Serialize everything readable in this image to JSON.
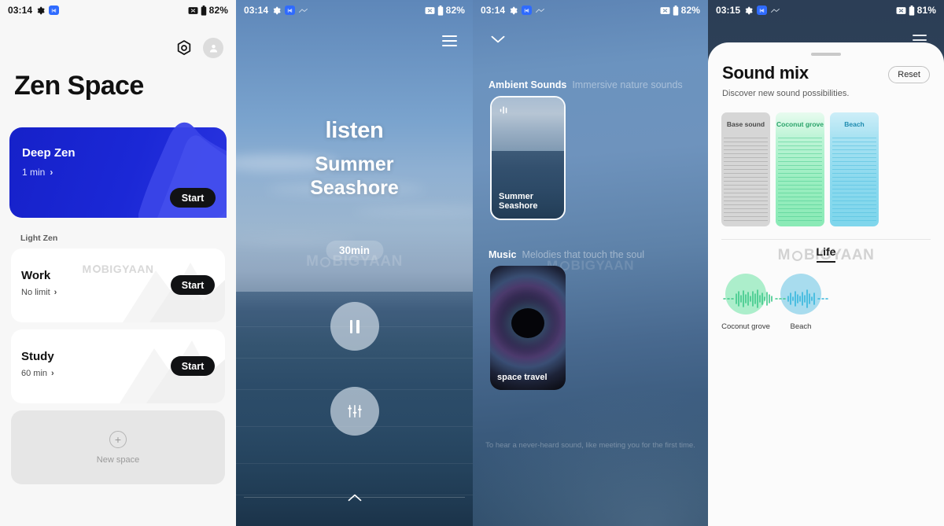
{
  "app": {
    "name": "Zen Space"
  },
  "panels": [
    {
      "id": "home",
      "statusbar": {
        "time": "03:14",
        "battery_pct": "82%",
        "icons": [
          "gear-icon",
          "dnd-badge-icon",
          "mute-icon",
          "battery-icon"
        ]
      },
      "header": {
        "title": "Zen Space",
        "settings_icon": "hex-gear-icon",
        "profile_icon": "avatar-icon"
      },
      "featured": {
        "name": "Deep Zen",
        "duration": "1 min",
        "chevron": "›",
        "start_label": "Start",
        "color": "#1b28d6"
      },
      "section_label": "Light Zen",
      "spaces": [
        {
          "name": "Work",
          "duration": "No limit",
          "chevron": "›",
          "start_label": "Start"
        },
        {
          "name": "Study",
          "duration": "60 min",
          "chevron": "›",
          "start_label": "Start"
        }
      ],
      "new_space": {
        "label": "New space",
        "icon": "plus-icon"
      },
      "watermark": "MOBIGYAAN"
    },
    {
      "id": "player",
      "statusbar": {
        "time": "03:14",
        "battery_pct": "82%"
      },
      "menu_icon": "hamburger-icon",
      "eyebrow": "listen",
      "track_title_line1": "Summer",
      "track_title_line2": "Seashore",
      "duration_chip": "30min",
      "controls": [
        {
          "name": "pause-button",
          "icon": "pause-icon"
        },
        {
          "name": "mixer-button",
          "icon": "equalizer-icon"
        }
      ],
      "expand_icon": "chevron-up-icon",
      "watermark": "MOBIGYAAN"
    },
    {
      "id": "browse",
      "statusbar": {
        "time": "03:14",
        "battery_pct": "82%"
      },
      "collapse_icon": "chevron-down-icon",
      "sections": [
        {
          "title": "Ambient Sounds",
          "subtitle": "Immersive nature sounds",
          "cards": [
            {
              "label": "Summer Seashore",
              "selected": true,
              "badge": "playing-equalizer-icon"
            }
          ]
        },
        {
          "title": "Music",
          "subtitle": "Melodies that touch the soul",
          "cards": [
            {
              "label": "space travel",
              "selected": false
            }
          ]
        }
      ],
      "footer_quote": "To hear a never-heard sound, like meeting you for the first time.",
      "watermark": "MOBIGYAAN"
    },
    {
      "id": "sound-mix",
      "statusbar": {
        "time": "03:15",
        "battery_pct": "81%"
      },
      "menu_icon": "hamburger-icon",
      "sheet": {
        "title": "Sound mix",
        "reset_label": "Reset",
        "subtitle": "Discover new sound possibilities.",
        "mixers": [
          {
            "label": "Base sound",
            "color": "#d6d6d6",
            "text_color": "#4a4a4a",
            "line_color": "#9a9a9a"
          },
          {
            "label": "Coconut grove",
            "color": "#a8f0c6",
            "text_color": "#2aa36a",
            "line_color": "#43c98c"
          },
          {
            "label": "Beach",
            "color": "#a6dff0",
            "text_color": "#1f8cb0",
            "line_color": "#49bcdd"
          }
        ],
        "tabs": [
          {
            "label": "Life",
            "active": true
          }
        ],
        "mix_items": [
          {
            "label": "Coconut grove",
            "color": "#aceecb",
            "wave_color": "#3fc98a"
          },
          {
            "label": "Beach",
            "color": "#a8dcee",
            "wave_color": "#35b6dc"
          }
        ]
      },
      "watermark": "MOBIGYAAN"
    }
  ]
}
